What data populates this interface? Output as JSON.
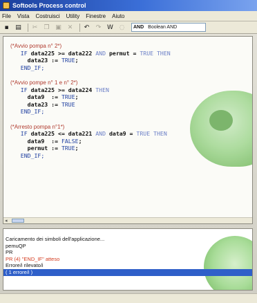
{
  "window": {
    "title": "Softools Process control"
  },
  "menu": [
    "File",
    "Vista",
    "Costruisci",
    "Utility",
    "Finestre",
    "Aiuto"
  ],
  "toolbar": {
    "buttons": [
      {
        "name": "save-icon",
        "glyph": "▪"
      },
      {
        "name": "print-icon",
        "glyph": "▤"
      },
      {
        "name": "cut-icon",
        "glyph": "✂"
      },
      {
        "name": "copy-icon",
        "glyph": "❐"
      },
      {
        "name": "paste-icon",
        "glyph": "▣"
      },
      {
        "name": "delete-icon",
        "glyph": "✕"
      },
      {
        "name": "undo-icon",
        "glyph": "↶"
      },
      {
        "name": "redo-icon",
        "glyph": "↷"
      },
      {
        "name": "compile-icon",
        "glyph": "W"
      },
      {
        "name": "help-icon",
        "glyph": "◌"
      }
    ],
    "operator_keyword": "AND",
    "operator_type": "Boolean AND"
  },
  "code_lines": [
    [
      {
        "t": "(*Avvio pompa n° 2*)",
        "c": "comment"
      }
    ],
    [
      {
        "t": "   IF ",
        "c": "kw"
      },
      {
        "t": "data225 >= data222 ",
        "c": "id"
      },
      {
        "t": "AND ",
        "c": "kw-faint"
      },
      {
        "t": "permut = ",
        "c": "id"
      },
      {
        "t": "TRUE THEN",
        "c": "kw-faint"
      }
    ],
    [
      {
        "t": "     data23 := ",
        "c": "id"
      },
      {
        "t": "TRUE",
        "c": "lit"
      },
      {
        "t": ";",
        "c": "id"
      }
    ],
    [
      {
        "t": "   END_IF;",
        "c": "kw"
      }
    ],
    [
      {
        "t": "",
        "c": "id"
      }
    ],
    [
      {
        "t": "(*Avvio pompe n° 1 e n° 2*)",
        "c": "comment"
      }
    ],
    [
      {
        "t": "   IF ",
        "c": "kw"
      },
      {
        "t": "data225 >= data224 ",
        "c": "id"
      },
      {
        "t": "THEN",
        "c": "kw-faint"
      }
    ],
    [
      {
        "t": "     data9  := ",
        "c": "id"
      },
      {
        "t": "TRUE",
        "c": "lit"
      },
      {
        "t": ";",
        "c": "id"
      }
    ],
    [
      {
        "t": "     data23 := ",
        "c": "id"
      },
      {
        "t": "TRUE",
        "c": "lit"
      }
    ],
    [
      {
        "t": "   END_IF;",
        "c": "kw"
      }
    ],
    [
      {
        "t": "",
        "c": "id"
      }
    ],
    [
      {
        "t": "(*Arresto pompa n°1*)",
        "c": "comment"
      }
    ],
    [
      {
        "t": "   IF ",
        "c": "kw"
      },
      {
        "t": "data225 <= data221 ",
        "c": "id"
      },
      {
        "t": "AND ",
        "c": "kw-faint"
      },
      {
        "t": "data9 = ",
        "c": "id"
      },
      {
        "t": "TRUE THEN",
        "c": "kw-faint"
      }
    ],
    [
      {
        "t": "     data9  := ",
        "c": "id"
      },
      {
        "t": "FALSE",
        "c": "lit"
      },
      {
        "t": ";",
        "c": "id"
      }
    ],
    [
      {
        "t": "     permut := ",
        "c": "id"
      },
      {
        "t": "TRUE",
        "c": "lit"
      },
      {
        "t": ";",
        "c": "id"
      }
    ],
    [
      {
        "t": "   END_IF;",
        "c": "kw"
      }
    ]
  ],
  "messages": [
    {
      "text": "Caricamento dei simboli dell'applicazione...",
      "kind": "normal"
    },
    {
      "text": "pemuQP",
      "kind": "normal"
    },
    {
      "text": "PR",
      "kind": "normal"
    },
    {
      "text": "PR (4) \"END_IF\" atteso",
      "kind": "error"
    },
    {
      "text": "Errore/i rilevato/i",
      "kind": "normal"
    },
    {
      "text": "( 1 errore/i )",
      "kind": "selected"
    }
  ],
  "colors": {
    "titlebar": "#1b3f9c",
    "keyword": "#1e3ea0",
    "comment": "#b03a2e",
    "error": "#d33b1f",
    "selection": "#2f5fc9"
  }
}
